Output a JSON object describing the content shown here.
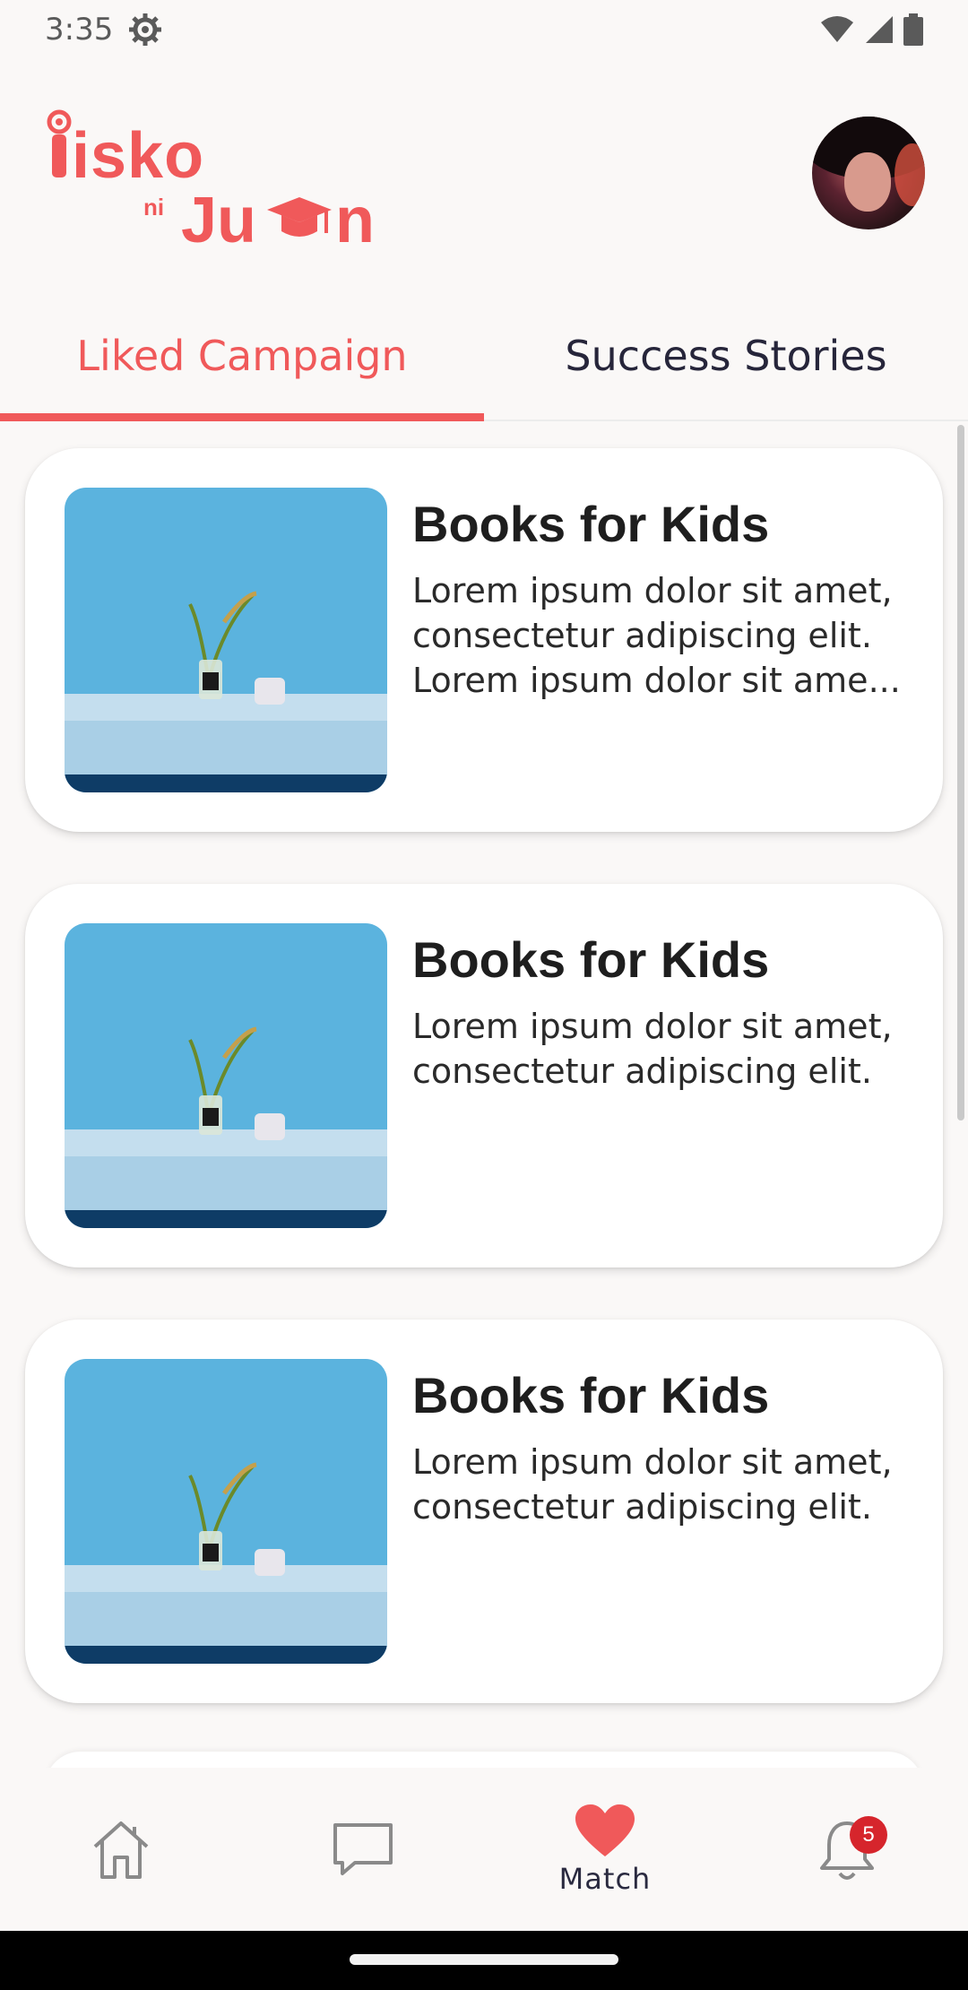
{
  "status_bar": {
    "time": "3:35"
  },
  "logo": {
    "line1": "isko",
    "small": "ni",
    "line2": "Juan"
  },
  "tabs": [
    {
      "label": "Liked Campaign",
      "active": true
    },
    {
      "label": "Success Stories",
      "active": false
    }
  ],
  "campaigns": [
    {
      "title": "Books for Kids",
      "desc": [
        "Lorem ipsum dolor sit amet,",
        "consectetur adipiscing elit.",
        "Lorem ipsum dolor sit ame..."
      ]
    },
    {
      "title": "Books for Kids",
      "desc": [
        "Lorem ipsum dolor sit amet,",
        "consectetur adipiscing elit."
      ]
    },
    {
      "title": "Books for Kids",
      "desc": [
        "Lorem ipsum dolor sit amet,",
        "consectetur adipiscing elit."
      ]
    }
  ],
  "nav": {
    "items": [
      {
        "name": "home",
        "icon": "home-icon"
      },
      {
        "name": "messages",
        "icon": "chat-icon"
      },
      {
        "name": "match",
        "icon": "heart-icon",
        "label": "Match",
        "active": true
      },
      {
        "name": "notifications",
        "icon": "bell-icon",
        "badge": "5"
      }
    ]
  },
  "colors": {
    "accent": "#f0595a",
    "badge": "#d6252c",
    "text_dark": "#26253a"
  }
}
